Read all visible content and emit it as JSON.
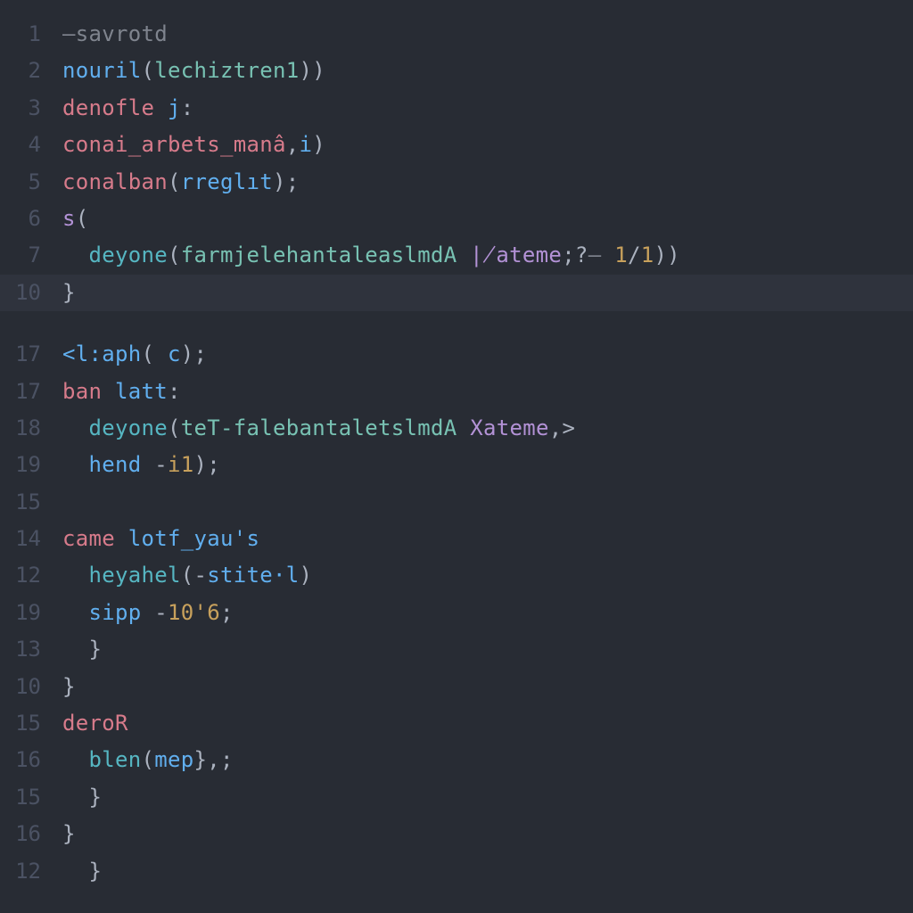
{
  "colors": {
    "background": "#282c34",
    "gutter": "#4b5263",
    "highlight": "#2f333d",
    "plain": "#abb2bf",
    "pink": "#d77b8b",
    "blue": "#61afef",
    "cyan": "#56b6c2",
    "green": "#78c2b3",
    "gold": "#c8a15c",
    "purple": "#b392d6"
  },
  "highlighted_index": 8,
  "lines": [
    {
      "num": "1",
      "tokens": [
        {
          "t": "–savrotd",
          "c": "c-mute"
        }
      ]
    },
    {
      "num": "2",
      "tokens": [
        {
          "t": "nouril",
          "c": "c-blue"
        },
        {
          "t": "(",
          "c": "c-plain"
        },
        {
          "t": "lechiztren1",
          "c": "c-green"
        },
        {
          "t": "))",
          "c": "c-plain"
        }
      ]
    },
    {
      "num": "3",
      "tokens": [
        {
          "t": "denofle",
          "c": "c-pink"
        },
        {
          "t": " ",
          "c": "c-plain"
        },
        {
          "t": "j",
          "c": "c-blue"
        },
        {
          "t": ":",
          "c": "c-plain"
        }
      ]
    },
    {
      "num": "4",
      "tokens": [
        {
          "t": "conai_arbets_manâ",
          "c": "c-pink"
        },
        {
          "t": ",",
          "c": "c-plain"
        },
        {
          "t": "i",
          "c": "c-blue"
        },
        {
          "t": ")",
          "c": "c-plain"
        }
      ]
    },
    {
      "num": "5",
      "tokens": [
        {
          "t": "conalban",
          "c": "c-pink"
        },
        {
          "t": "(",
          "c": "c-plain"
        },
        {
          "t": "rreglıt",
          "c": "c-blue"
        },
        {
          "t": ");",
          "c": "c-plain"
        }
      ]
    },
    {
      "num": "6",
      "tokens": [
        {
          "t": "s",
          "c": "c-purple"
        },
        {
          "t": "(",
          "c": "c-plain"
        }
      ]
    },
    {
      "num": "7",
      "tokens": [
        {
          "t": "  ",
          "c": "c-plain"
        },
        {
          "t": "deyone",
          "c": "c-cyan"
        },
        {
          "t": "(",
          "c": "c-plain"
        },
        {
          "t": "farmjelehantaleaslmdA",
          "c": "c-green"
        },
        {
          "t": " ",
          "c": "c-plain"
        },
        {
          "t": "∤ateme",
          "c": "c-purple"
        },
        {
          "t": ";?",
          "c": "c-plain"
        },
        {
          "t": "– ",
          "c": "c-mute"
        },
        {
          "t": "1",
          "c": "c-gold"
        },
        {
          "t": "/",
          "c": "c-plain"
        },
        {
          "t": "1",
          "c": "c-gold"
        },
        {
          "t": "))",
          "c": "c-plain"
        }
      ]
    },
    {
      "num": "10",
      "hl": true,
      "tokens": [
        {
          "t": "}",
          "c": "c-plain"
        }
      ]
    },
    {
      "gap": true
    },
    {
      "num": "17",
      "tokens": [
        {
          "t": "<l:aph",
          "c": "c-blue"
        },
        {
          "t": "( ",
          "c": "c-plain"
        },
        {
          "t": "c",
          "c": "c-blue"
        },
        {
          "t": ");",
          "c": "c-plain"
        }
      ]
    },
    {
      "num": "17",
      "tokens": [
        {
          "t": "ban",
          "c": "c-pink"
        },
        {
          "t": " ",
          "c": "c-plain"
        },
        {
          "t": "latt",
          "c": "c-blue"
        },
        {
          "t": ":",
          "c": "c-plain"
        }
      ]
    },
    {
      "num": "18",
      "tokens": [
        {
          "t": "  ",
          "c": "c-plain"
        },
        {
          "t": "deyone",
          "c": "c-cyan"
        },
        {
          "t": "(",
          "c": "c-plain"
        },
        {
          "t": "teT-falebantaletslmdA",
          "c": "c-green"
        },
        {
          "t": " ",
          "c": "c-plain"
        },
        {
          "t": "Xateme",
          "c": "c-purple"
        },
        {
          "t": ",>",
          "c": "c-plain"
        }
      ]
    },
    {
      "num": "19",
      "tokens": [
        {
          "t": "  ",
          "c": "c-plain"
        },
        {
          "t": "hend",
          "c": "c-blue"
        },
        {
          "t": " -",
          "c": "c-plain"
        },
        {
          "t": "i1",
          "c": "c-gold"
        },
        {
          "t": ");",
          "c": "c-plain"
        }
      ]
    },
    {
      "num": "15",
      "tokens": []
    },
    {
      "num": "14",
      "tokens": [
        {
          "t": "came",
          "c": "c-pink"
        },
        {
          "t": " ",
          "c": "c-plain"
        },
        {
          "t": "lotf_yau's",
          "c": "c-blue"
        }
      ]
    },
    {
      "num": "12",
      "tokens": [
        {
          "t": "  ",
          "c": "c-plain"
        },
        {
          "t": "heyahel",
          "c": "c-cyan"
        },
        {
          "t": "(-",
          "c": "c-plain"
        },
        {
          "t": "stite·l",
          "c": "c-blue"
        },
        {
          "t": ")",
          "c": "c-plain"
        }
      ]
    },
    {
      "num": "19",
      "tokens": [
        {
          "t": "  ",
          "c": "c-plain"
        },
        {
          "t": "sipp",
          "c": "c-blue"
        },
        {
          "t": " -",
          "c": "c-plain"
        },
        {
          "t": "10'6",
          "c": "c-gold"
        },
        {
          "t": ";",
          "c": "c-plain"
        }
      ]
    },
    {
      "num": "13",
      "tokens": [
        {
          "t": "  }",
          "c": "c-plain"
        }
      ]
    },
    {
      "num": "10",
      "tokens": [
        {
          "t": "}",
          "c": "c-plain"
        }
      ]
    },
    {
      "num": "15",
      "tokens": [
        {
          "t": "deroR",
          "c": "c-pink"
        }
      ]
    },
    {
      "num": "16",
      "tokens": [
        {
          "t": "  ",
          "c": "c-plain"
        },
        {
          "t": "blen",
          "c": "c-cyan"
        },
        {
          "t": "(",
          "c": "c-plain"
        },
        {
          "t": "mep",
          "c": "c-blue"
        },
        {
          "t": "},;",
          "c": "c-plain"
        }
      ]
    },
    {
      "num": "15",
      "tokens": [
        {
          "t": "  }",
          "c": "c-plain"
        }
      ]
    },
    {
      "num": "16",
      "tokens": [
        {
          "t": "}",
          "c": "c-plain"
        }
      ]
    },
    {
      "num": "12",
      "tokens": [
        {
          "t": "  }",
          "c": "c-plain"
        }
      ]
    }
  ]
}
